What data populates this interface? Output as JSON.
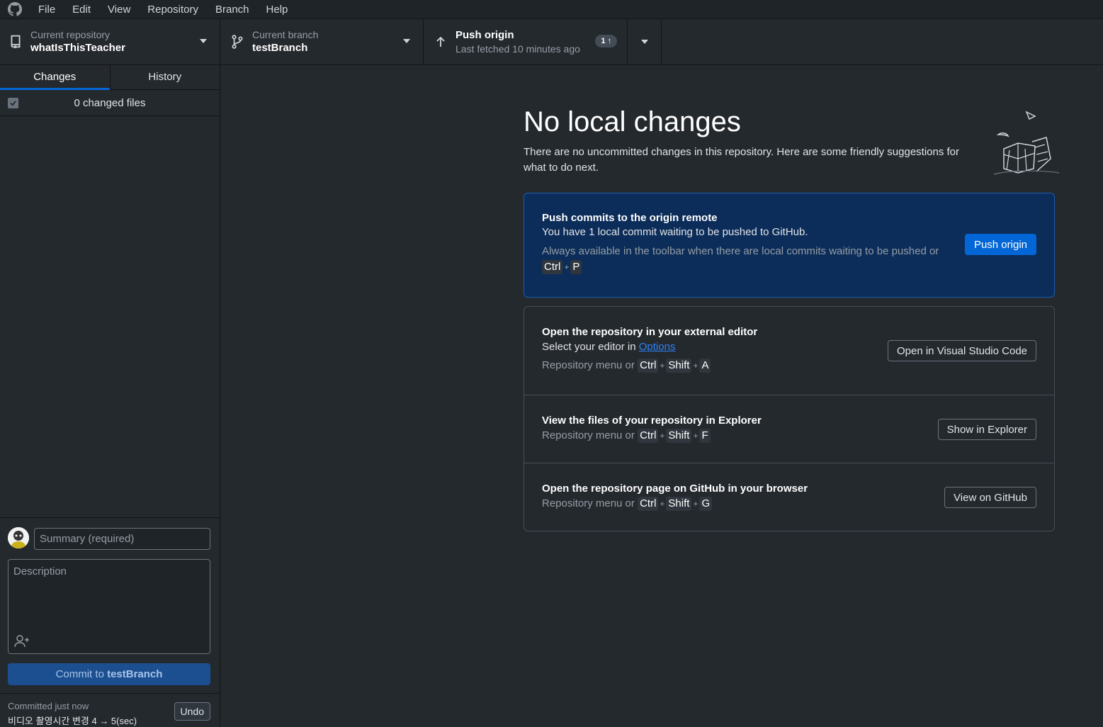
{
  "menu": {
    "items": [
      "File",
      "Edit",
      "View",
      "Repository",
      "Branch",
      "Help"
    ]
  },
  "toolbar": {
    "repo_label": "Current repository",
    "repo_name": "whatIsThisTeacher",
    "branch_label": "Current branch",
    "branch_name": "testBranch",
    "push_title": "Push origin",
    "push_subtitle": "Last fetched 10 minutes ago",
    "push_badge": "1 ↑"
  },
  "sidebar": {
    "tabs": [
      {
        "label": "Changes",
        "active": true
      },
      {
        "label": "History",
        "active": false
      }
    ],
    "changed_files": "0 changed files",
    "summary_placeholder": "Summary (required)",
    "description_placeholder": "Description",
    "commit_prefix": "Commit to ",
    "commit_branch": "testBranch",
    "last_commit_label": "Committed just now",
    "last_commit_message": "비디오 촬영시간 변경 4 → 5(sec)",
    "undo_label": "Undo"
  },
  "main": {
    "heading": "No local changes",
    "subtext": "There are no uncommitted changes in this repository. Here are some friendly suggestions for what to do next.",
    "push_card": {
      "title": "Push commits to the origin remote",
      "text": "You have 1 local commit waiting to be pushed to GitHub.",
      "hint": "Always available in the toolbar when there are local commits waiting to be pushed or",
      "keys": [
        "Ctrl",
        "P"
      ],
      "button": "Push origin"
    },
    "editor_card": {
      "title": "Open the repository in your external editor",
      "text_prefix": "Select your editor in ",
      "link": "Options",
      "hint": "Repository menu or",
      "keys": [
        "Ctrl",
        "Shift",
        "A"
      ],
      "button": "Open in Visual Studio Code"
    },
    "explorer_card": {
      "title": "View the files of your repository in Explorer",
      "hint": "Repository menu or",
      "keys": [
        "Ctrl",
        "Shift",
        "F"
      ],
      "button": "Show in Explorer"
    },
    "github_card": {
      "title": "Open the repository page on GitHub in your browser",
      "hint": "Repository menu or",
      "keys": [
        "Ctrl",
        "Shift",
        "G"
      ],
      "button": "View on GitHub"
    }
  },
  "colors": {
    "accent": "#0366d6",
    "background": "#24292e",
    "highlight_card": "#0c2d59"
  }
}
